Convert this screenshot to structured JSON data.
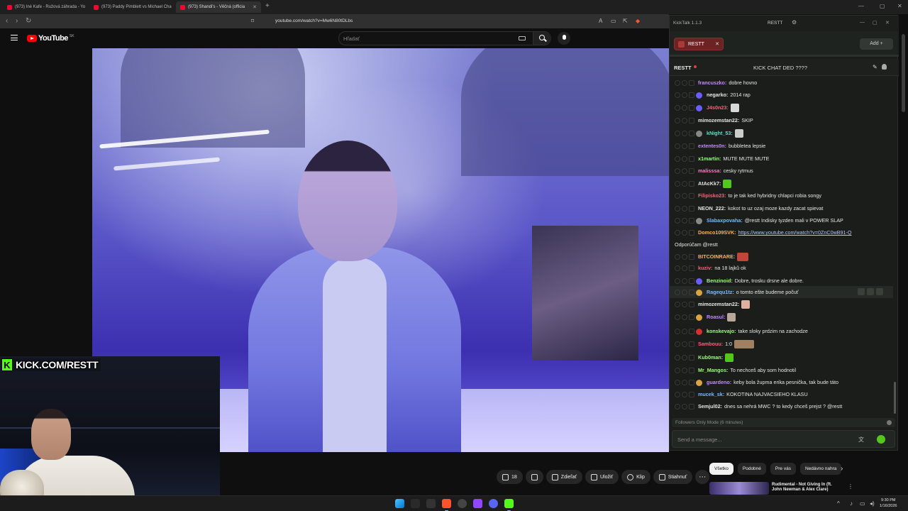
{
  "browser": {
    "tabs": [
      {
        "label": "(973) Iné Kafe - Ružová záhrada - Yo"
      },
      {
        "label": "(973) Paddy Pimblett vs Michael Cha"
      },
      {
        "label": "(973) Shandi's - Věčná (officia"
      }
    ],
    "url": "youtube.com/watch?v=Mw6N80tDLbs"
  },
  "youtube": {
    "logo_text": "YouTube",
    "country_code": "SK",
    "search_placeholder": "Hľadať",
    "actions": {
      "likes": "18",
      "share": "Zdieľať",
      "save": "Uložiť",
      "clip": "Klip",
      "download": "Stiahnuť"
    },
    "chips": [
      "Všetko",
      "Podobné",
      "Pre vás",
      "Nedávno nahra"
    ],
    "recommendation": {
      "title": "Rudimental - Not Giving In (ft. John Newman & Alex Clare)"
    }
  },
  "overlay": {
    "kick_logo": "K",
    "kick_url": "KICK.COM/RESTT"
  },
  "kicktalk": {
    "app_title": "KickTalk 1.1.3",
    "user": "RESTT",
    "tab_label": "RESTT",
    "add_label": "Add +",
    "channel": "RESTT",
    "stream_title": "KICK CHAT DED ????",
    "follow_mode": "Followers Only Mode (6 minutes)",
    "input_placeholder": "Send a message...",
    "colors": {
      "accent_green": "#53fc18",
      "tab_red": "#6b2323"
    },
    "messages": [
      {
        "user": "francuszko:",
        "color": "#c58aff",
        "text": "dobre hovno"
      },
      {
        "user": "negarko:",
        "color": "#e6e6e6",
        "text": "2014 rap",
        "badge": "#6a5cff"
      },
      {
        "user": "J4s0n23:",
        "color": "#ff5f7a",
        "text": "",
        "badge": "#6a5cff",
        "emote": "#d8d8d8"
      },
      {
        "user": "mimozemstan22:",
        "color": "#e6e6e6",
        "text": "SKIP"
      },
      {
        "user": "kNight_53:",
        "color": "#5fe0c8",
        "text": "",
        "badge": "#888888",
        "emote": "#cccccc"
      },
      {
        "user": "extentes0n:",
        "color": "#c58aff",
        "text": "bubbletea lepsie"
      },
      {
        "user": "x1martin:",
        "color": "#9dff7a",
        "text": "MUTE MUTE MUTE"
      },
      {
        "user": "malisssa:",
        "color": "#ff7ac0",
        "text": "cesky rytmus"
      },
      {
        "user": "AtAcKk7:",
        "color": "#e6e6e6",
        "text": "",
        "emote": "#53c71c"
      },
      {
        "user": "Filipisko23:",
        "color": "#ff5f7a",
        "text": "to je tak ked hybridny chlapci robia songy"
      },
      {
        "user": "NEON_222:",
        "color": "#e6e6e6",
        "text": "kokot to uz ozaj moze kazdy zacat spievat"
      },
      {
        "user": "Slabaxpovaha:",
        "color": "#7ab8ff",
        "text": "@restt Indisky tyzden mali v POWER SLAP",
        "badge": "#888888"
      },
      {
        "user": "Domco109SVK:",
        "color": "#ffb347",
        "text": "",
        "link": "https://www.youtube.com/watch?v=0ZnC0wB91-Q"
      },
      {
        "user": "",
        "color": "#e6e6e6",
        "text": "Odporúčam @restt"
      },
      {
        "user": "BITCOINRARE:",
        "color": "#ffb347",
        "text": "",
        "emote": "#c2453a"
      },
      {
        "user": "kuziv:",
        "color": "#ff5f7a",
        "text": "na 18 lajkŭ ok"
      },
      {
        "user": "Benzinoid:",
        "color": "#9dff7a",
        "text": "Dobre, trosku drsne ale dobre.",
        "badge": "#6a5cff"
      },
      {
        "user": "Ragequ1tz:",
        "color": "#7ab8ff",
        "text": "o tomto ešte budeme počuť",
        "badge": "#d9a441"
      },
      {
        "user": "mimozemstan22:",
        "color": "#e6e6e6",
        "text": "",
        "emote": "#e0b0a0"
      },
      {
        "user": "Roasul:",
        "color": "#c58aff",
        "text": "",
        "badge": "#d9a441",
        "emote": "#b8a898"
      },
      {
        "user": "konskevajo:",
        "color": "#9dff7a",
        "text": "take sloky prdzim na zachodze",
        "badge": "#d43030"
      },
      {
        "user": "Sambouu:",
        "color": "#ff5f7a",
        "text": "1:0",
        "emote": "#a08060"
      },
      {
        "user": "Kub0man:",
        "color": "#9dff7a",
        "text": "",
        "emote": "#53c71c"
      },
      {
        "user": "Mr_Mangos:",
        "color": "#9dff7a",
        "text": "To nechceš aby som hodnotil"
      },
      {
        "user": "guardeno:",
        "color": "#c58aff",
        "text": "keby bola župma erika pesnička, tak bude táto",
        "badge": "#d9a441"
      },
      {
        "user": "mucek_sk:",
        "color": "#7ab8ff",
        "text": "KOKOTINA NAJVACSIEHO KLASU"
      },
      {
        "user": "Semjul02:",
        "color": "#e6e6e6",
        "text": "dnes sa nehrá MWC ? to kedy chceš prejst ? @restt"
      }
    ]
  },
  "taskbar": {
    "time": "9:30 PM",
    "date": "1/16/2026"
  }
}
